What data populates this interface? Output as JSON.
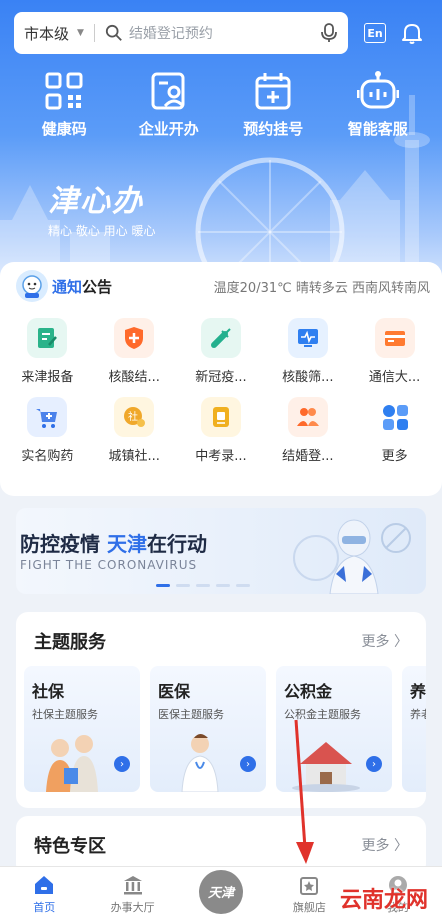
{
  "header": {
    "city": "市本级",
    "search_placeholder": "结婚登记预约",
    "lang_label": "En"
  },
  "quick_actions": [
    {
      "label": "健康码",
      "icon": "qr-code-icon"
    },
    {
      "label": "企业开办",
      "icon": "enterprise-icon"
    },
    {
      "label": "预约挂号",
      "icon": "calendar-plus-icon"
    },
    {
      "label": "智能客服",
      "icon": "robot-icon"
    }
  ],
  "brand": {
    "logo_text": "津心办",
    "slogan": "精心 敬心 用心 暖心"
  },
  "notice": {
    "title_a": "通知",
    "title_b": "公告",
    "text": "温度20/31℃ 晴转多云 西南风转南风"
  },
  "services": [
    {
      "label": "来津报备",
      "icon": "report-icon",
      "bg": "#e6f7f2",
      "fg": "#2bb38a"
    },
    {
      "label": "核酸结...",
      "icon": "shield-plus-icon",
      "bg": "#fff0e8",
      "fg": "#ff6a2b"
    },
    {
      "label": "新冠疫...",
      "icon": "syringe-icon",
      "bg": "#e6f7f2",
      "fg": "#24b08e"
    },
    {
      "label": "核酸筛...",
      "icon": "monitor-pulse-icon",
      "bg": "#e6f1ff",
      "fg": "#2f7ff0"
    },
    {
      "label": "通信大...",
      "icon": "card-icon",
      "bg": "#fff0e8",
      "fg": "#ff7a30"
    },
    {
      "label": "实名购药",
      "icon": "cart-plus-icon",
      "bg": "#e6efff",
      "fg": "#2f6fe8"
    },
    {
      "label": "城镇社...",
      "icon": "social-badge-icon",
      "bg": "#fff6e0",
      "fg": "#f0a82b"
    },
    {
      "label": "中考录...",
      "icon": "exam-icon",
      "bg": "#fff6e0",
      "fg": "#f0b020"
    },
    {
      "label": "结婚登...",
      "icon": "couple-icon",
      "bg": "#fff0e8",
      "fg": "#ff6a2b"
    },
    {
      "label": "更多",
      "icon": "more-grid-icon",
      "bg": "#ffffff",
      "fg": "#2f7ff0"
    }
  ],
  "banner": {
    "title_a": "防控疫情 ",
    "title_b": "天津",
    "title_c": "在行动",
    "subtitle": "FIGHT THE CORONAVIRUS"
  },
  "theme_services": {
    "title": "主题服务",
    "more": "更多 〉",
    "items": [
      {
        "title": "社保",
        "sub": "社保主题服务"
      },
      {
        "title": "医保",
        "sub": "医保主题服务"
      },
      {
        "title": "公积金",
        "sub": "公积金主题服务"
      },
      {
        "title": "养",
        "sub": "养老"
      }
    ]
  },
  "special_zone": {
    "title": "特色专区",
    "more": "更多 〉"
  },
  "tabs": [
    {
      "label": "首页",
      "active": true
    },
    {
      "label": "办事大厅",
      "active": false
    },
    {
      "label": "天津",
      "center": true
    },
    {
      "label": "旗舰店",
      "active": false
    },
    {
      "label": "我的",
      "active": false
    }
  ],
  "watermark": "云南龙网",
  "colors": {
    "accent": "#2f6fe8",
    "hero_top": "#3a82f4"
  }
}
